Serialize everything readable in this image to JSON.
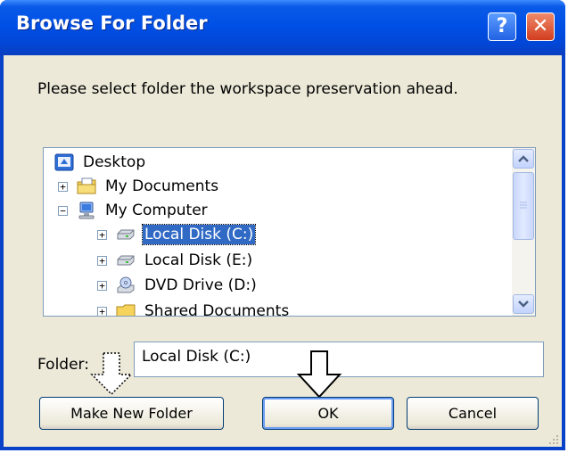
{
  "window": {
    "title": "Browse For Folder",
    "help_label": "?",
    "close_label": "✕"
  },
  "prompt": "Please select folder the workspace preservation ahead.",
  "tree": {
    "items": [
      {
        "label": "Desktop",
        "icon": "desktop-icon"
      },
      {
        "label": "My Documents",
        "icon": "documents-folder-icon",
        "expander": "+"
      },
      {
        "label": "My Computer",
        "icon": "computer-icon",
        "expander": "−"
      },
      {
        "label": "Local Disk (C:)",
        "icon": "hard-disk-icon",
        "expander": "+",
        "selected": true
      },
      {
        "label": "Local Disk (E:)",
        "icon": "hard-disk-icon",
        "expander": "+"
      },
      {
        "label": "DVD Drive (D:)",
        "icon": "dvd-drive-icon",
        "expander": "+"
      },
      {
        "label": "Shared Documents",
        "icon": "shared-folder-icon",
        "expander": "+"
      }
    ]
  },
  "folder": {
    "label": "Folder:",
    "value": "Local Disk (C:)"
  },
  "buttons": {
    "new_folder": "Make New Folder",
    "ok": "OK",
    "cancel": "Cancel"
  },
  "colors": {
    "titlebar": "#0050e6",
    "selection": "#316ac5",
    "dialog_face": "#ece9d8"
  }
}
